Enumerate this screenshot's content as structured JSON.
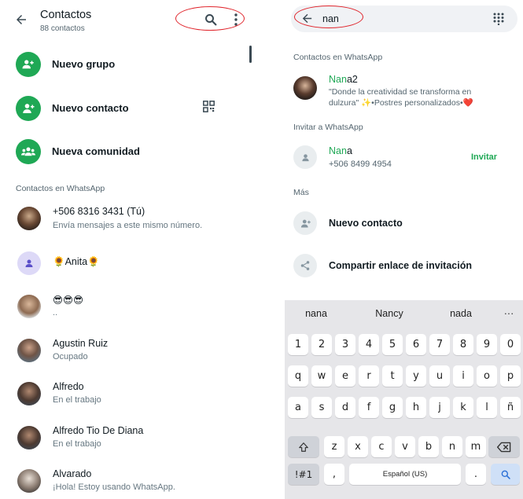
{
  "left": {
    "header": {
      "back_icon": "arrow-left-icon",
      "title": "Contactos",
      "subtitle": "88 contactos",
      "search_icon": "search-icon",
      "menu_icon": "more-vertical-icon"
    },
    "actions": [
      {
        "label": "Nuevo grupo",
        "icon": "group-add-icon"
      },
      {
        "label": "Nuevo contacto",
        "icon": "person-add-icon",
        "trailing_icon": "qr-code-icon"
      },
      {
        "label": "Nueva comunidad",
        "icon": "community-icon"
      }
    ],
    "section_title": "Contactos en WhatsApp",
    "contacts": [
      {
        "name": "+506 8316 3431 (Tú)",
        "status": "Envía mensajes a este mismo número."
      },
      {
        "name": "🌻Anita🌻",
        "status": ""
      },
      {
        "name": "😎😎😎",
        "status": ".."
      },
      {
        "name": "Agustin Ruiz",
        "status": "Ocupado"
      },
      {
        "name": "Alfredo",
        "status": "En el trabajo"
      },
      {
        "name": "Alfredo Tio De Diana",
        "status": "En el trabajo"
      },
      {
        "name": "Alvarado",
        "status": "¡Hola! Estoy usando WhatsApp."
      }
    ]
  },
  "right": {
    "search": {
      "value": "nan",
      "back_icon": "arrow-left-icon",
      "dialpad_icon": "dialpad-icon"
    },
    "section_whatsapp": "Contactos en WhatsApp",
    "match": {
      "name_hl": "Nan",
      "name_rest": "a2",
      "status": "\"Donde la creatividad se transforma en dulzura\" ✨•Postres personalizados•❤️"
    },
    "section_invite": "Invitar a WhatsApp",
    "invite": {
      "name_hl": "Nan",
      "name_rest": "a",
      "phone": "+506 8499 4954",
      "button": "Invitar"
    },
    "section_more": "Más",
    "more": [
      {
        "label": "Nuevo contacto",
        "icon": "person-add-icon"
      },
      {
        "label": "Compartir enlace de invitación",
        "icon": "share-icon"
      }
    ],
    "keyboard": {
      "suggestions": [
        "nana",
        "Nancy",
        "nada",
        "···"
      ],
      "row_numbers": [
        "1",
        "2",
        "3",
        "4",
        "5",
        "6",
        "7",
        "8",
        "9",
        "0"
      ],
      "row_1": [
        "q",
        "w",
        "e",
        "r",
        "t",
        "y",
        "u",
        "i",
        "o",
        "p"
      ],
      "row_2": [
        "a",
        "s",
        "d",
        "f",
        "g",
        "h",
        "j",
        "k",
        "l",
        "ñ"
      ],
      "row_3": [
        "z",
        "x",
        "c",
        "v",
        "b",
        "n",
        "m"
      ],
      "shift_icon": "shift-icon",
      "backspace_icon": "backspace-icon",
      "symbols": "!#1",
      "comma": ",",
      "space": "Español (US)",
      "period": ".",
      "search_key_icon": "search-icon"
    }
  },
  "colors": {
    "accent": "#1fa855",
    "annotation": "#e0242b"
  }
}
